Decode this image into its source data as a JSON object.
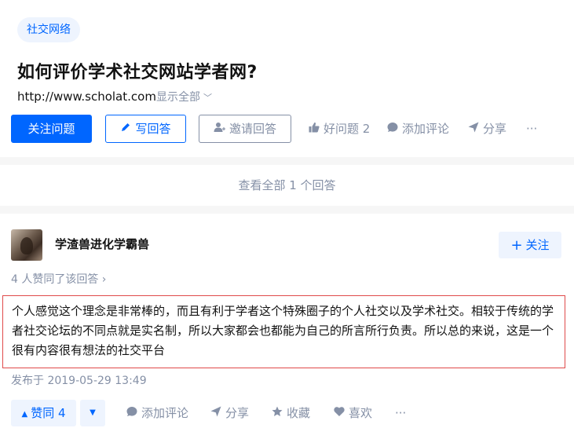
{
  "question": {
    "topic_tag": "社交网络",
    "title": "如何评价学术社交网站学者网?",
    "link": "http://www.scholat.com",
    "show_all": "显示全部",
    "actions": {
      "follow": "关注问题",
      "write": "写回答",
      "invite": "邀请回答",
      "good_question": "好问题 2",
      "add_comment": "添加评论",
      "share": "分享",
      "more": "···"
    }
  },
  "view_all": "查看全部 1 个回答",
  "answer": {
    "author": "学渣兽进化学霸兽",
    "follow_button": "关注",
    "voters": "4 人赞同了该回答 ›",
    "content": "个人感觉这个理念是非常棒的，而且有利于学者这个特殊圈子的个人社交以及学术社交。相较于传统的学者社交论坛的不同点就是实名制，所以大家都会也都能为自己的所言所行负责。所以总的来说，这是一个很有内容很有想法的社交平台",
    "published": "发布于 2019-05-29 13:49",
    "actions": {
      "upvote": "赞同 4",
      "add_comment": "添加评论",
      "share": "分享",
      "collect": "收藏",
      "like": "喜欢",
      "more": "···"
    }
  },
  "colors": {
    "brand": "#0066ff",
    "muted": "#8590a6",
    "highlight_border": "#e04a4a"
  }
}
